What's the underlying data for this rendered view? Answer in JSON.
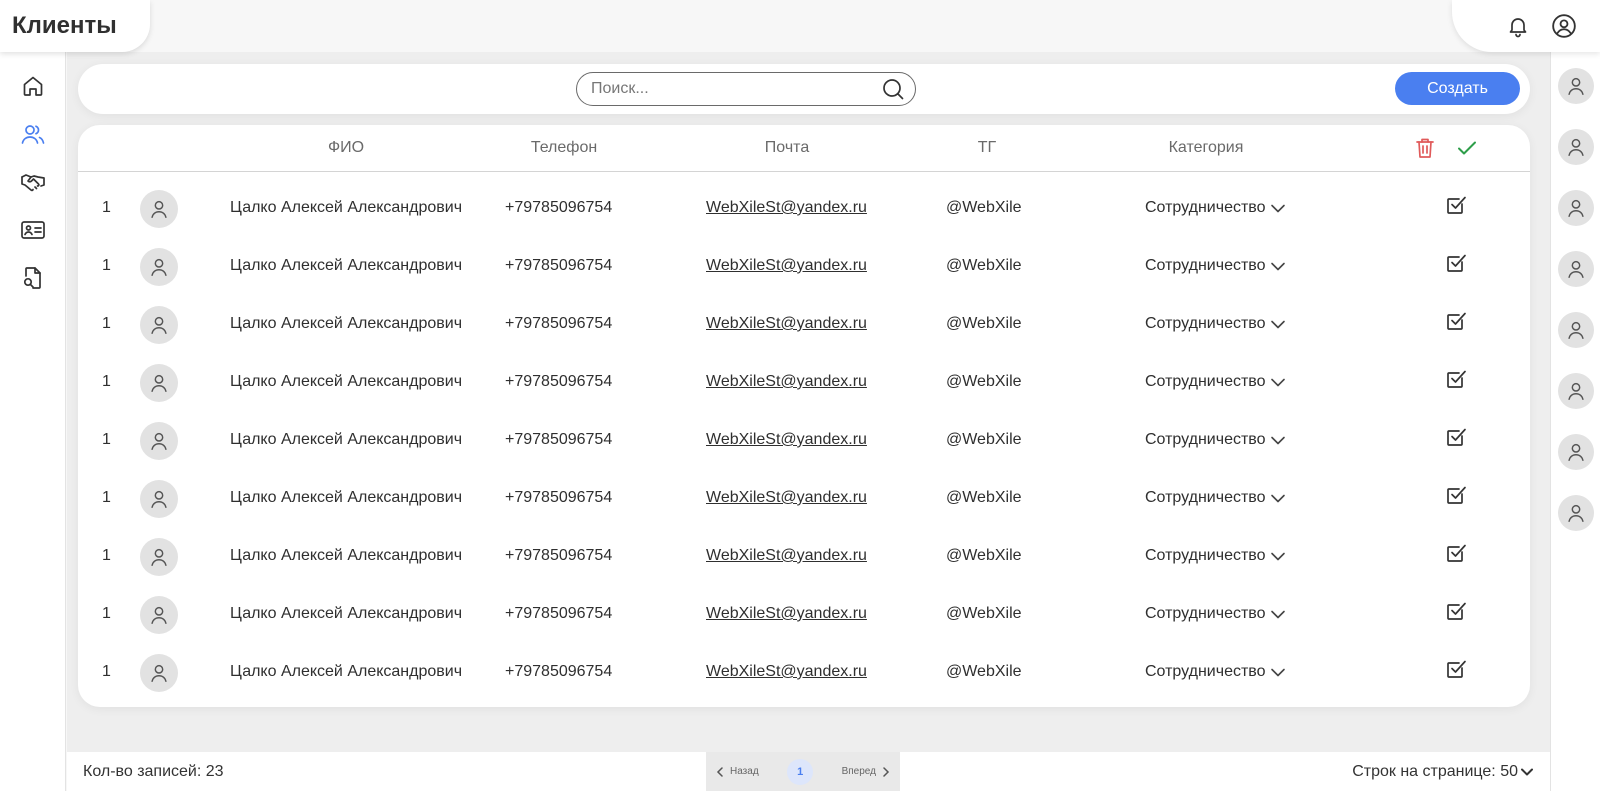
{
  "header": {
    "title": "Клиенты",
    "bell_icon": "bell-icon",
    "profile_icon": "user-circle-icon"
  },
  "left_nav": [
    {
      "id": "home",
      "icon": "home-icon"
    },
    {
      "id": "clients",
      "icon": "users-icon",
      "active": true
    },
    {
      "id": "partners",
      "icon": "handshake-icon"
    },
    {
      "id": "cards",
      "icon": "id-card-icon"
    },
    {
      "id": "documents",
      "icon": "document-search-icon"
    }
  ],
  "search": {
    "placeholder": "Поиск...",
    "value": ""
  },
  "toolbar": {
    "create_label": "Создать"
  },
  "table": {
    "columns": {
      "fio": "ФИО",
      "phone": "Телефон",
      "email": "Почта",
      "tg": "ТГ",
      "category": "Категория"
    },
    "rows": [
      {
        "num": "1",
        "fio": "Цалко Алексей Александрович",
        "phone": "+79785096754",
        "email": "WebXileSt@yandex.ru",
        "tg": "@WebXile",
        "category": "Сотрудничество",
        "checked": true
      },
      {
        "num": "1",
        "fio": "Цалко Алексей Александрович",
        "phone": "+79785096754",
        "email": "WebXileSt@yandex.ru",
        "tg": "@WebXile",
        "category": "Сотрудничество",
        "checked": true
      },
      {
        "num": "1",
        "fio": "Цалко Алексей Александрович",
        "phone": "+79785096754",
        "email": "WebXileSt@yandex.ru",
        "tg": "@WebXile",
        "category": "Сотрудничество",
        "checked": true
      },
      {
        "num": "1",
        "fio": "Цалко Алексей Александрович",
        "phone": "+79785096754",
        "email": "WebXileSt@yandex.ru",
        "tg": "@WebXile",
        "category": "Сотрудничество",
        "checked": true
      },
      {
        "num": "1",
        "fio": "Цалко Алексей Александрович",
        "phone": "+79785096754",
        "email": "WebXileSt@yandex.ru",
        "tg": "@WebXile",
        "category": "Сотрудничество",
        "checked": true
      },
      {
        "num": "1",
        "fio": "Цалко Алексей Александрович",
        "phone": "+79785096754",
        "email": "WebXileSt@yandex.ru",
        "tg": "@WebXile",
        "category": "Сотрудничество",
        "checked": true
      },
      {
        "num": "1",
        "fio": "Цалко Алексей Александрович",
        "phone": "+79785096754",
        "email": "WebXileSt@yandex.ru",
        "tg": "@WebXile",
        "category": "Сотрудничество",
        "checked": true
      },
      {
        "num": "1",
        "fio": "Цалко Алексей Александрович",
        "phone": "+79785096754",
        "email": "WebXileSt@yandex.ru",
        "tg": "@WebXile",
        "category": "Сотрудничество",
        "checked": true
      },
      {
        "num": "1",
        "fio": "Цалко Алексей Александрович",
        "phone": "+79785096754",
        "email": "WebXileSt@yandex.ru",
        "tg": "@WebXile",
        "category": "Сотрудничество",
        "checked": true
      }
    ]
  },
  "right_sidebar": {
    "avatars": [
      "user-icon",
      "user-icon",
      "user-icon",
      "user-icon",
      "user-icon",
      "user-icon",
      "user-icon",
      "user-icon"
    ]
  },
  "footer": {
    "records_label": "Кол-во записей: 23",
    "prev_label": "Назад",
    "current_page": "1",
    "next_label": "Вперед",
    "rows_per_page_label": "Строк на странице: 50"
  },
  "colors": {
    "accent": "#4a7ff0",
    "delete": "#e05a5a",
    "confirm": "#2e9e4a"
  }
}
